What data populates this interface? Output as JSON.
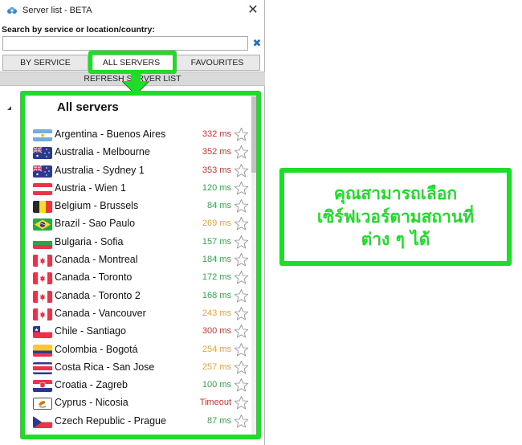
{
  "window": {
    "title": "Server list - BETA",
    "close_icon": "close-icon"
  },
  "search": {
    "label": "Search by service or location/country:",
    "value": "",
    "placeholder": "",
    "clear_icon": "clear-x-icon"
  },
  "tabs": [
    {
      "label": "BY SERVICE",
      "active": false
    },
    {
      "label": "ALL SERVERS",
      "active": true
    },
    {
      "label": "FAVOURITES",
      "active": false
    }
  ],
  "refresh_label": "REFRESH SERVER LIST",
  "list": {
    "title": "All servers",
    "servers": [
      {
        "name": "Argentina - Buenos Aires",
        "ping": "332 ms",
        "status": "bad",
        "flag": "argentina-flag"
      },
      {
        "name": "Australia - Melbourne",
        "ping": "352 ms",
        "status": "bad",
        "flag": "australia-flag"
      },
      {
        "name": "Australia - Sydney 1",
        "ping": "353 ms",
        "status": "bad",
        "flag": "australia-flag"
      },
      {
        "name": "Austria - Wien 1",
        "ping": "120 ms",
        "status": "good",
        "flag": "austria-flag"
      },
      {
        "name": "Belgium - Brussels",
        "ping": "84 ms",
        "status": "good",
        "flag": "belgium-flag"
      },
      {
        "name": "Brazil - Sao Paulo",
        "ping": "269 ms",
        "status": "medium",
        "flag": "brazil-flag"
      },
      {
        "name": "Bulgaria - Sofia",
        "ping": "157 ms",
        "status": "good",
        "flag": "bulgaria-flag"
      },
      {
        "name": "Canada - Montreal",
        "ping": "184 ms",
        "status": "good",
        "flag": "canada-flag"
      },
      {
        "name": "Canada - Toronto",
        "ping": "172 ms",
        "status": "good",
        "flag": "canada-flag"
      },
      {
        "name": "Canada - Toronto 2",
        "ping": "168 ms",
        "status": "good",
        "flag": "canada-flag"
      },
      {
        "name": "Canada - Vancouver",
        "ping": "243 ms",
        "status": "medium",
        "flag": "canada-flag"
      },
      {
        "name": "Chile - Santiago",
        "ping": "300 ms",
        "status": "bad",
        "flag": "chile-flag"
      },
      {
        "name": "Colombia - Bogotá",
        "ping": "254 ms",
        "status": "medium",
        "flag": "colombia-flag"
      },
      {
        "name": "Costa Rica - San Jose",
        "ping": "257 ms",
        "status": "medium",
        "flag": "costa-rica-flag"
      },
      {
        "name": "Croatia - Zagreb",
        "ping": "100 ms",
        "status": "good",
        "flag": "croatia-flag"
      },
      {
        "name": "Cyprus - Nicosia",
        "ping": "Timeout",
        "status": "bad",
        "flag": "cyprus-flag"
      },
      {
        "name": "Czech Republic - Prague",
        "ping": "87 ms",
        "status": "good",
        "flag": "czech-flag"
      }
    ]
  },
  "colors": {
    "good": "#2aa84a",
    "medium": "#e8a034",
    "bad": "#d0312d",
    "highlight": "#1edc28"
  },
  "callout": {
    "text": "คุณสามารถเลือก\nเซิร์ฟเวอร์ตามสถานที่\nต่าง ๆ ได้"
  }
}
